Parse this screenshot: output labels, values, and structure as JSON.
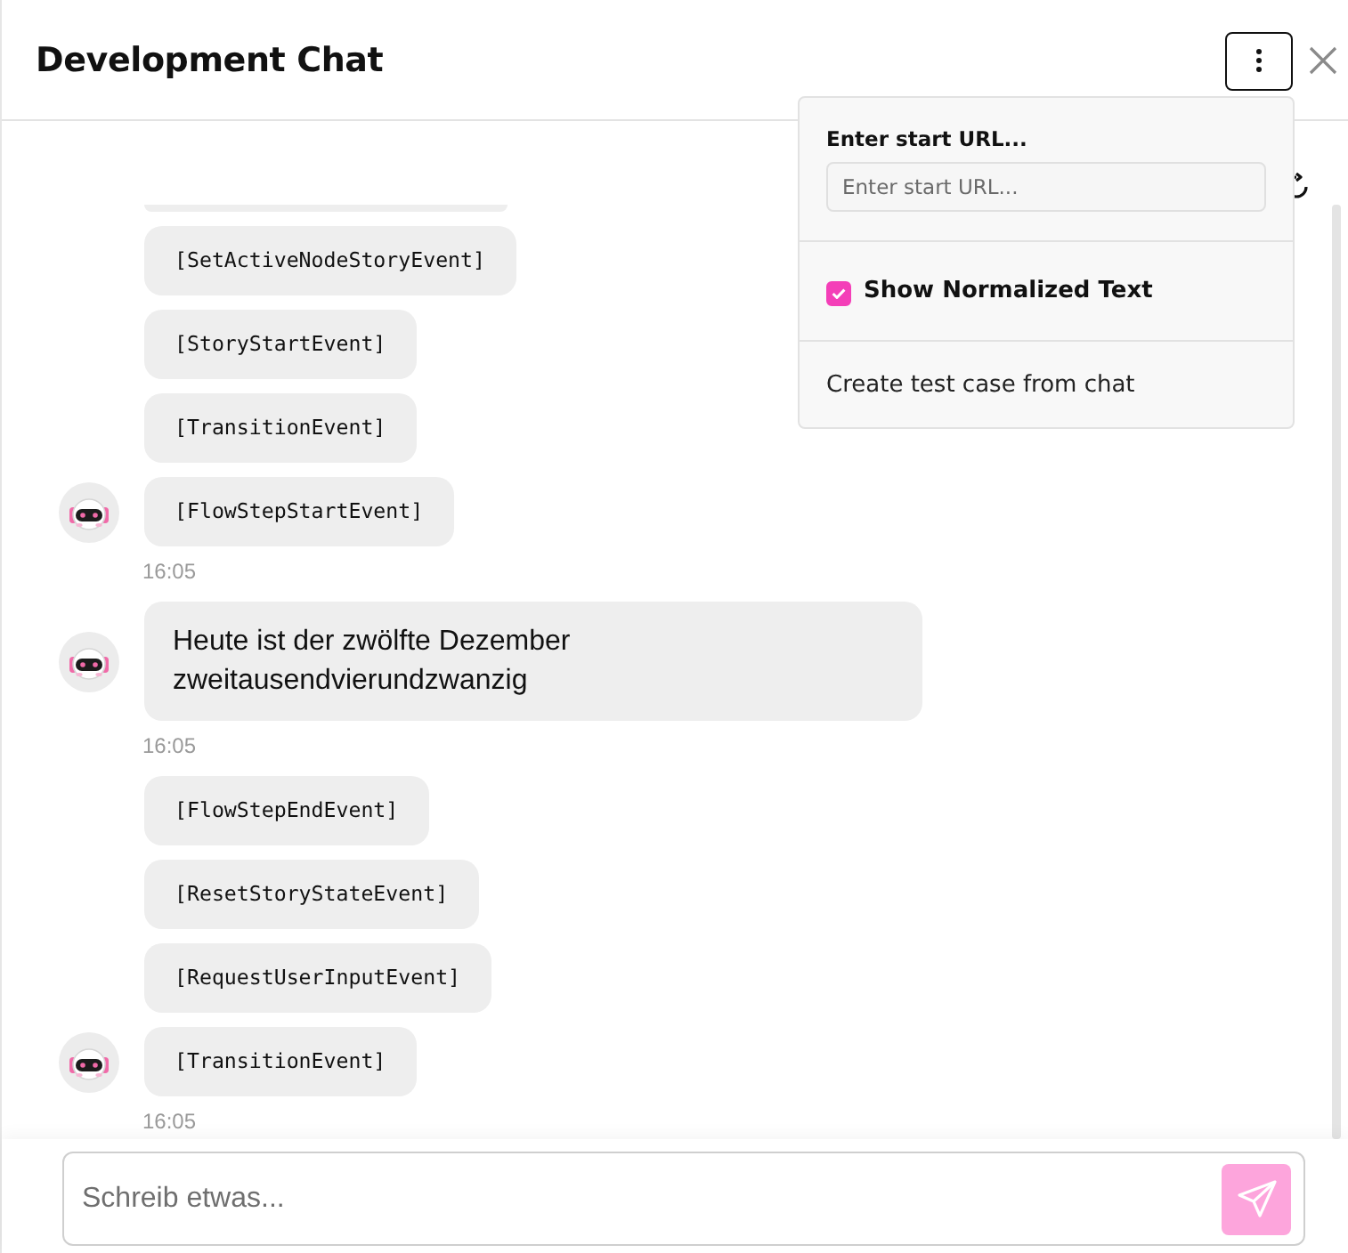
{
  "header": {
    "title": "Development Chat",
    "menu_expanded": true
  },
  "menu": {
    "url_label": "Enter start URL...",
    "url_placeholder": "Enter start URL...",
    "options": [
      {
        "kind": "checkbox",
        "label": "Show Normalized Text",
        "checked": true
      },
      {
        "kind": "action",
        "label": "Create test case from chat"
      }
    ]
  },
  "messages": [
    {
      "bubbles": [
        {
          "kind": "clipped"
        },
        {
          "kind": "event",
          "text": "[SetActiveNodeStoryEvent]"
        },
        {
          "kind": "event",
          "text": "[StoryStartEvent]"
        },
        {
          "kind": "event",
          "text": "[TransitionEvent]"
        },
        {
          "kind": "event",
          "text": "[FlowStepStartEvent]"
        }
      ],
      "time": "16:05"
    },
    {
      "bubbles": [
        {
          "kind": "text",
          "text": "Heute ist der zwölfte Dezember zweitausendvierundzwanzig"
        }
      ],
      "time": "16:05"
    },
    {
      "bubbles": [
        {
          "kind": "event",
          "text": "[FlowStepEndEvent]"
        },
        {
          "kind": "event",
          "text": "[ResetStoryStateEvent]"
        },
        {
          "kind": "event",
          "text": "[RequestUserInputEvent]"
        },
        {
          "kind": "event",
          "text": "[TransitionEvent]"
        }
      ],
      "time": "16:05"
    }
  ],
  "composer": {
    "placeholder": "Schreib etwas..."
  }
}
